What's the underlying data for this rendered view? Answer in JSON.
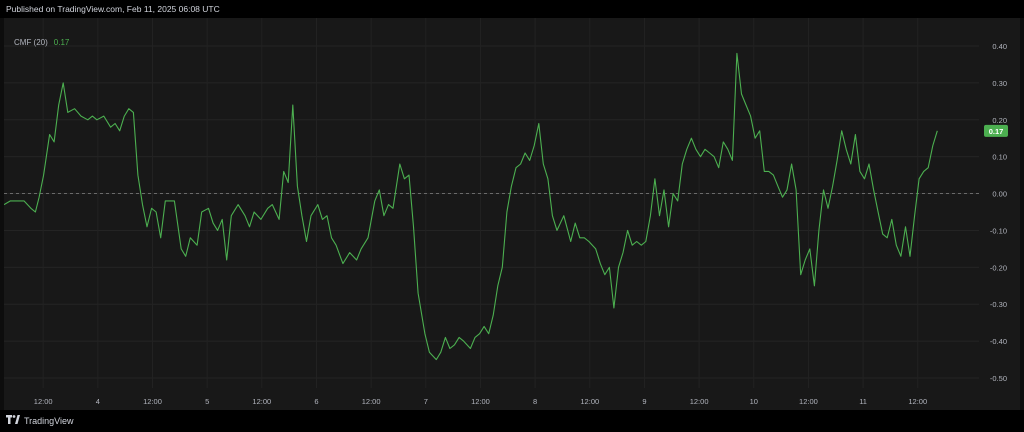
{
  "header": {
    "published": "Published on TradingView.com, Feb 11, 2025 06:08 UTC"
  },
  "legend": {
    "indicator": "CMF (20)",
    "value": "0.17"
  },
  "footer": {
    "brand": "TradingView"
  },
  "colors": {
    "line": "#4caf50",
    "last_value_bg": "#4caf50",
    "background": "#181818",
    "axis_text": "#b2b5be"
  },
  "chart_data": {
    "type": "line",
    "title": "CMF (20)",
    "ylim": [
      -0.5,
      0.4
    ],
    "y_ticks": [
      0.4,
      0.3,
      0.2,
      0.1,
      0.0,
      -0.1,
      -0.2,
      -0.3,
      -0.4,
      -0.5
    ],
    "y_tick_labels": [
      "0.40",
      "0.30",
      "0.20",
      "0.10",
      "0.00",
      "-0.10",
      "-0.20",
      "-0.30",
      "-0.40",
      "-0.50"
    ],
    "x_tick_labels": [
      "12:00",
      "4",
      "12:00",
      "5",
      "12:00",
      "6",
      "12:00",
      "7",
      "12:00",
      "8",
      "12:00",
      "9",
      "12:00",
      "10",
      "12:00",
      "11",
      "12:00"
    ],
    "x_tick_times": [
      -12,
      0,
      12,
      24,
      36,
      48,
      60,
      72,
      84,
      96,
      108,
      120,
      132,
      144,
      156,
      168,
      180
    ],
    "x_range": [
      -20.6,
      186.2
    ],
    "zero_line": 0.0,
    "last_value_label": "0.17",
    "grid": true,
    "series": [
      {
        "values": [
          [
            -20.6,
            -0.03
          ],
          [
            -19.2,
            -0.02
          ],
          [
            -17.7,
            -0.02
          ],
          [
            -16.2,
            -0.02
          ],
          [
            -14.7,
            -0.04
          ],
          [
            -13.7,
            -0.05
          ],
          [
            -12.9,
            -0.01
          ],
          [
            -11.9,
            0.05
          ],
          [
            -10.6,
            0.16
          ],
          [
            -9.6,
            0.14
          ],
          [
            -8.6,
            0.24
          ],
          [
            -7.6,
            0.3
          ],
          [
            -6.6,
            0.22
          ],
          [
            -5.1,
            0.23
          ],
          [
            -3.7,
            0.21
          ],
          [
            -2.2,
            0.2
          ],
          [
            -1.2,
            0.21
          ],
          [
            -0.2,
            0.2
          ],
          [
            1.3,
            0.21
          ],
          [
            2.8,
            0.18
          ],
          [
            3.8,
            0.19
          ],
          [
            4.8,
            0.17
          ],
          [
            5.8,
            0.21
          ],
          [
            6.8,
            0.23
          ],
          [
            7.8,
            0.22
          ],
          [
            8.8,
            0.05
          ],
          [
            9.8,
            -0.03
          ],
          [
            10.8,
            -0.09
          ],
          [
            11.8,
            -0.04
          ],
          [
            12.8,
            -0.05
          ],
          [
            13.8,
            -0.12
          ],
          [
            14.8,
            -0.02
          ],
          [
            16.8,
            -0.02
          ],
          [
            18.3,
            -0.15
          ],
          [
            19.3,
            -0.17
          ],
          [
            20.3,
            -0.12
          ],
          [
            21.8,
            -0.14
          ],
          [
            22.8,
            -0.05
          ],
          [
            24.3,
            -0.04
          ],
          [
            25.3,
            -0.08
          ],
          [
            26.3,
            -0.1
          ],
          [
            27.3,
            -0.07
          ],
          [
            28.3,
            -0.18
          ],
          [
            29.3,
            -0.06
          ],
          [
            30.8,
            -0.03
          ],
          [
            32.3,
            -0.06
          ],
          [
            33.3,
            -0.09
          ],
          [
            34.3,
            -0.05
          ],
          [
            35.8,
            -0.07
          ],
          [
            37.3,
            -0.04
          ],
          [
            38.3,
            -0.03
          ],
          [
            39.8,
            -0.07
          ],
          [
            40.8,
            0.06
          ],
          [
            41.8,
            0.03
          ],
          [
            42.8,
            0.24
          ],
          [
            43.8,
            0.02
          ],
          [
            44.8,
            -0.06
          ],
          [
            45.8,
            -0.13
          ],
          [
            46.8,
            -0.06
          ],
          [
            48.3,
            -0.03
          ],
          [
            49.3,
            -0.07
          ],
          [
            50.3,
            -0.06
          ],
          [
            51.3,
            -0.12
          ],
          [
            52.3,
            -0.14
          ],
          [
            53.8,
            -0.19
          ],
          [
            55.3,
            -0.16
          ],
          [
            56.8,
            -0.18
          ],
          [
            57.8,
            -0.15
          ],
          [
            59.3,
            -0.12
          ],
          [
            60.8,
            -0.02
          ],
          [
            61.8,
            0.01
          ],
          [
            62.8,
            -0.06
          ],
          [
            63.8,
            -0.03
          ],
          [
            64.8,
            -0.04
          ],
          [
            66.3,
            0.08
          ],
          [
            67.3,
            0.04
          ],
          [
            68.3,
            0.05
          ],
          [
            69.3,
            -0.09
          ],
          [
            70.3,
            -0.27
          ],
          [
            71.8,
            -0.38
          ],
          [
            72.8,
            -0.43
          ],
          [
            74.3,
            -0.45
          ],
          [
            75.3,
            -0.43
          ],
          [
            76.3,
            -0.39
          ],
          [
            77.3,
            -0.42
          ],
          [
            78.3,
            -0.41
          ],
          [
            79.3,
            -0.39
          ],
          [
            80.3,
            -0.4
          ],
          [
            81.8,
            -0.42
          ],
          [
            82.8,
            -0.39
          ],
          [
            83.8,
            -0.38
          ],
          [
            84.8,
            -0.36
          ],
          [
            85.8,
            -0.38
          ],
          [
            86.8,
            -0.33
          ],
          [
            87.8,
            -0.25
          ],
          [
            88.8,
            -0.2
          ],
          [
            89.8,
            -0.05
          ],
          [
            90.8,
            0.02
          ],
          [
            91.8,
            0.07
          ],
          [
            92.8,
            0.08
          ],
          [
            93.8,
            0.11
          ],
          [
            94.8,
            0.09
          ],
          [
            95.8,
            0.13
          ],
          [
            96.8,
            0.19
          ],
          [
            97.8,
            0.08
          ],
          [
            98.8,
            0.04
          ],
          [
            99.8,
            -0.06
          ],
          [
            100.8,
            -0.1
          ],
          [
            102.3,
            -0.06
          ],
          [
            103.8,
            -0.13
          ],
          [
            104.8,
            -0.08
          ],
          [
            105.8,
            -0.12
          ],
          [
            106.8,
            -0.12
          ],
          [
            107.8,
            -0.13
          ],
          [
            109.3,
            -0.15
          ],
          [
            110.3,
            -0.19
          ],
          [
            111.3,
            -0.22
          ],
          [
            112.3,
            -0.2
          ],
          [
            113.3,
            -0.31
          ],
          [
            114.3,
            -0.2
          ],
          [
            115.3,
            -0.16
          ],
          [
            116.3,
            -0.1
          ],
          [
            117.3,
            -0.14
          ],
          [
            118.3,
            -0.13
          ],
          [
            119.3,
            -0.14
          ],
          [
            120.3,
            -0.13
          ],
          [
            121.3,
            -0.06
          ],
          [
            122.3,
            0.04
          ],
          [
            123.3,
            -0.06
          ],
          [
            124.3,
            0.01
          ],
          [
            125.3,
            -0.09
          ],
          [
            126.3,
            0.0
          ],
          [
            127.3,
            -0.02
          ],
          [
            128.3,
            0.08
          ],
          [
            129.3,
            0.12
          ],
          [
            130.3,
            0.15
          ],
          [
            131.3,
            0.12
          ],
          [
            132.3,
            0.1
          ],
          [
            133.3,
            0.12
          ],
          [
            134.3,
            0.11
          ],
          [
            135.3,
            0.1
          ],
          [
            136.3,
            0.07
          ],
          [
            137.3,
            0.14
          ],
          [
            138.3,
            0.12
          ],
          [
            139.3,
            0.09
          ],
          [
            140.3,
            0.38
          ],
          [
            141.3,
            0.27
          ],
          [
            142.3,
            0.24
          ],
          [
            143.3,
            0.21
          ],
          [
            144.3,
            0.15
          ],
          [
            145.3,
            0.17
          ],
          [
            146.3,
            0.06
          ],
          [
            147.3,
            0.06
          ],
          [
            148.3,
            0.05
          ],
          [
            149.3,
            0.02
          ],
          [
            150.3,
            -0.01
          ],
          [
            151.3,
            0.01
          ],
          [
            152.3,
            0.08
          ],
          [
            153.3,
            0.01
          ],
          [
            154.3,
            -0.22
          ],
          [
            155.3,
            -0.18
          ],
          [
            156.3,
            -0.15
          ],
          [
            157.3,
            -0.25
          ],
          [
            158.3,
            -0.1
          ],
          [
            159.3,
            0.01
          ],
          [
            160.3,
            -0.04
          ],
          [
            161.3,
            0.02
          ],
          [
            162.3,
            0.09
          ],
          [
            163.3,
            0.17
          ],
          [
            164.3,
            0.12
          ],
          [
            165.3,
            0.08
          ],
          [
            166.3,
            0.16
          ],
          [
            167.3,
            0.06
          ],
          [
            168.3,
            0.04
          ],
          [
            169.3,
            0.08
          ],
          [
            170.3,
            0.01
          ],
          [
            171.3,
            -0.05
          ],
          [
            172.3,
            -0.11
          ],
          [
            173.3,
            -0.12
          ],
          [
            174.3,
            -0.07
          ],
          [
            175.3,
            -0.14
          ],
          [
            176.3,
            -0.17
          ],
          [
            177.3,
            -0.09
          ],
          [
            178.3,
            -0.17
          ],
          [
            179.3,
            -0.06
          ],
          [
            180.3,
            0.04
          ],
          [
            181.3,
            0.06
          ],
          [
            182.3,
            0.07
          ],
          [
            183.3,
            0.13
          ],
          [
            184.3,
            0.17
          ]
        ]
      }
    ]
  }
}
